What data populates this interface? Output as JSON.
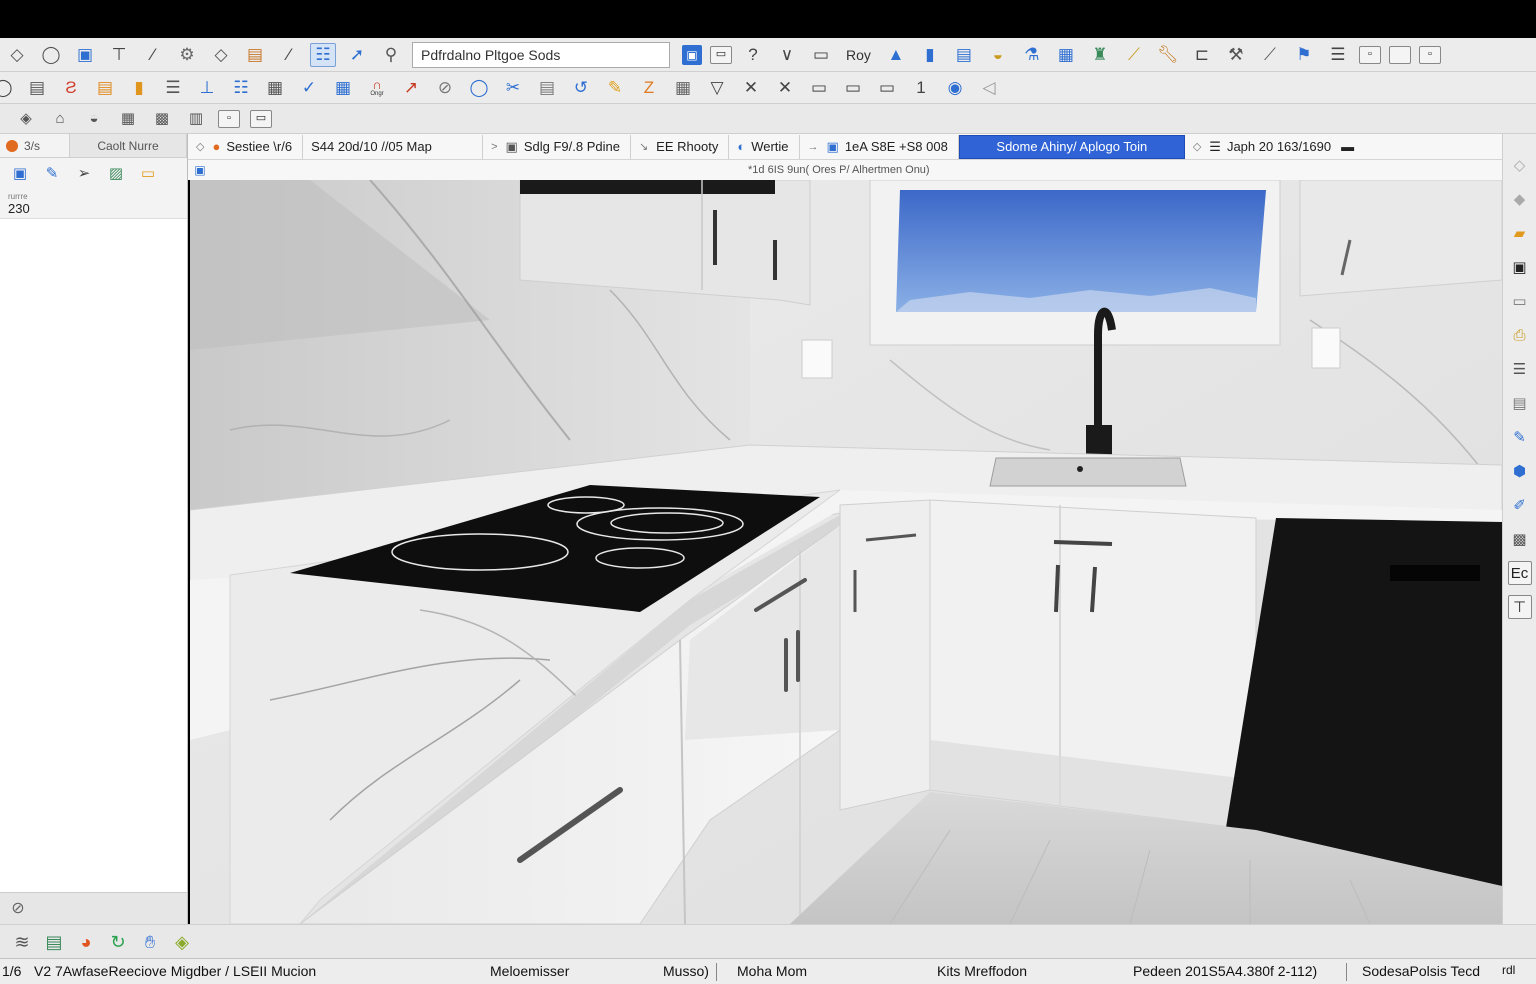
{
  "toolbar_row1": {
    "icons": [
      "select-icon",
      "lasso-icon",
      "save-icon",
      "paint-roller-icon",
      "pencil-icon",
      "gear-icon",
      "eraser-icon",
      "window-icon",
      "line-tool-icon",
      "layers-icon",
      "arrow-icon",
      "pin-icon"
    ],
    "search_value": "Pdfrdalno Pltgoe Sods",
    "icons_after": [
      "blue-square-icon",
      "frame-icon",
      "question-icon",
      "chevron-down-icon",
      "minimize-icon"
    ],
    "label_roy": "Roy",
    "icons_right": [
      "blue-triangle-icon",
      "panel-icon",
      "panel-blue-icon",
      "globe-icon",
      "paint-bucket-icon",
      "calendar-icon",
      "stamp-icon",
      "ruler-icon",
      "wrench-icon",
      "bracket-icon",
      "hammer-icon",
      "screwdriver-icon",
      "tools-icon",
      "menu-icon",
      "restore-icon",
      "maximize-icon",
      "split-icon"
    ]
  },
  "toolbar_row2": {
    "icons": [
      "circle-icon",
      "table-icon",
      "red-flag-icon",
      "chart-orange-icon",
      "orange-folder-icon",
      "list-icon",
      "staircase-icon",
      "stack-icon",
      "grid-icon",
      "edit-icon",
      "grid-blue-icon",
      "magnet-icon",
      "red-arrow-icon",
      "eraser-round-icon",
      "ring-icon",
      "scissors-icon",
      "notes-icon",
      "blue-curve-icon",
      "yellow-pencil-icon",
      "orange-z-icon",
      "calculator-icon",
      "triangle-down-icon",
      "close-icon",
      "cross-icon",
      "square-icon",
      "square-outline-icon",
      "square-dark-icon",
      "number-one-icon",
      "blue-circle-icon",
      "back-arrow-icon"
    ],
    "label_mid": "Ongr"
  },
  "toolbar_row3": {
    "icons": [
      "tilt-icon",
      "brush-icon",
      "planet-icon",
      "layout-icon",
      "grid-square-icon",
      "building-icon",
      "ticket-icon",
      "screen-icon"
    ]
  },
  "left_panel": {
    "tabs": [
      {
        "label": "3/s",
        "name": "tab-3s"
      },
      {
        "label": "Caolt Nurre",
        "name": "tab-caolt-nurre"
      }
    ],
    "icons": [
      "monitor-icon",
      "notebook-icon",
      "arrow-right-icon",
      "toolbox-icon",
      "laptop-icon"
    ],
    "small_label": "rurrre",
    "value": "230",
    "bottom_icon": "eye-icon"
  },
  "viewport_tabs": [
    {
      "arrow": "◇",
      "icon": "●",
      "label": "Sestiee  \\r/6",
      "name": "tab-sestiee"
    },
    {
      "arrow": "",
      "icon": "",
      "label": "S44 20d/10 //05 Map",
      "name": "tab-map"
    },
    {
      "arrow": ">",
      "icon": "▣",
      "label": "Sdlg F9/.8 Pdine",
      "name": "tab-sdlg"
    },
    {
      "arrow": "↘",
      "icon": "",
      "label": "EE Rhooty",
      "name": "tab-rhooty"
    },
    {
      "arrow": "",
      "icon": "◐",
      "label": "Wertie",
      "name": "tab-wertie"
    },
    {
      "arrow": "→",
      "icon": "▣",
      "label": "1eA S8E +S8 008",
      "name": "tab-number"
    },
    {
      "arrow": "",
      "icon": "",
      "label": "Sdome Ahiny/ Aplogo Toin",
      "name": "tab-active",
      "active": true
    },
    {
      "arrow": "◇",
      "icon": "☰",
      "label": "Japh 20 163/1690",
      "name": "tab-japh"
    }
  ],
  "viewport_subtitle": "*1d 6IS 9un( Ores P/ Alhertmen Onu)",
  "right_panel": {
    "icons": [
      "diamond-icon",
      "diamond-alt-icon",
      "folder-orange-icon",
      "window-black-icon",
      "blank-doc-icon",
      "print-icon",
      "list-lines-icon",
      "archive-icon",
      "pen-icon",
      "paint-icon",
      "edit-blue-icon",
      "picture-icon",
      "text-ec-icon",
      "pin-down-icon"
    ]
  },
  "bottom_toolbar": {
    "icons": [
      "stroke-icon",
      "layers-stack-icon",
      "browser-icon",
      "refresh-green-icon",
      "hand-icon",
      "palette-icon"
    ]
  },
  "statusbar": {
    "items": [
      "1/6",
      "V2 7AwfaseReeciove Migdber / LSEII Mucion",
      "Meloemisser",
      "Musso)",
      "Moha Mom",
      "Kits Mreffodon",
      "Pedeen 201S5A4.380f 2-112)",
      "SodesaPolsis Tecd",
      "rdl"
    ]
  },
  "colors": {
    "accent": "#2f63d6",
    "toolbar_bg": "#ececec",
    "titlebar": "#000000"
  }
}
